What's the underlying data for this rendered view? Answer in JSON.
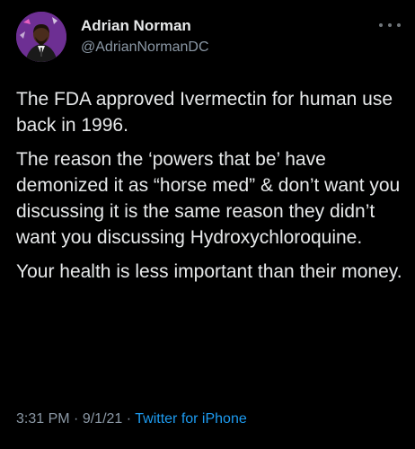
{
  "author": {
    "display_name": "Adrian Norman",
    "handle": "@AdrianNormanDC"
  },
  "tweet": {
    "paragraphs": [
      "The FDA approved Ivermectin for human use back in 1996.",
      "The reason the ‘powers that be’ have demonized it as “horse med” & don’t want you discussing it is the same reason they didn’t want you discussing Hydroxychloroquine.",
      "Your health is less important than their money."
    ]
  },
  "meta": {
    "time": "3:31 PM",
    "separator": "·",
    "date": "9/1/21",
    "source": "Twitter for iPhone"
  },
  "icons": {
    "more": "more-options-icon",
    "avatar": "profile-avatar"
  },
  "colors": {
    "background": "#000000",
    "text": "#e7e9ea",
    "secondary_text": "#8b98a5",
    "link": "#1d9bf0",
    "avatar_bg": "#6d2f93"
  }
}
